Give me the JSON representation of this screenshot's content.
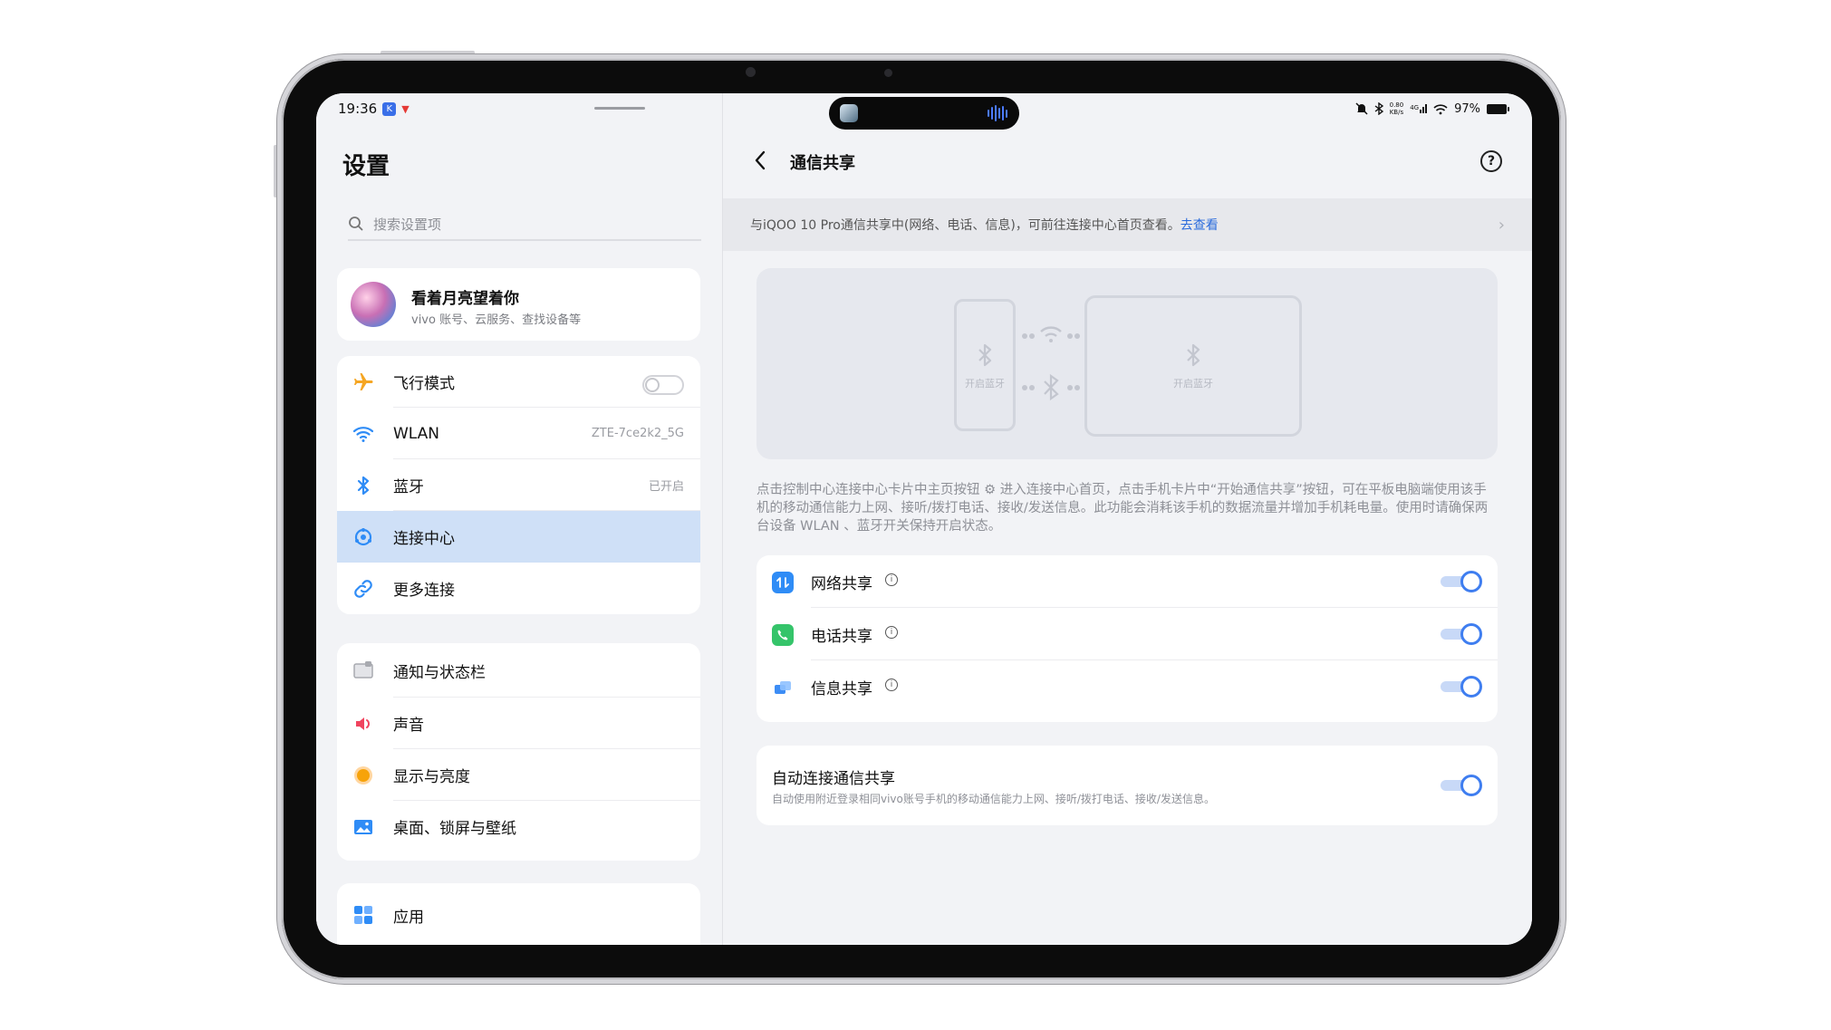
{
  "status": {
    "time": "19:36",
    "netspeed_top": "0.80",
    "netspeed_bottom": "KB/s",
    "network": "4G",
    "battery": "97%"
  },
  "left": {
    "title": "设置",
    "search_placeholder": "搜索设置项",
    "profile": {
      "name": "看着月亮望着你",
      "subtitle": "vivo 账号、云服务、查找设备等"
    },
    "group1": [
      {
        "label": "飞行模式",
        "icon": "airplane-icon",
        "value": ""
      },
      {
        "label": "WLAN",
        "icon": "wifi-icon",
        "value": "ZTE-7ce2k2_5G"
      },
      {
        "label": "蓝牙",
        "icon": "bluetooth-icon",
        "value": "已开启"
      },
      {
        "label": "连接中心",
        "icon": "connection-center-icon",
        "value": ""
      },
      {
        "label": "更多连接",
        "icon": "link-icon",
        "value": ""
      }
    ],
    "group2": [
      {
        "label": "通知与状态栏",
        "icon": "notification-icon"
      },
      {
        "label": "声音",
        "icon": "sound-icon"
      },
      {
        "label": "显示与亮度",
        "icon": "brightness-icon"
      },
      {
        "label": "桌面、锁屏与壁纸",
        "icon": "wallpaper-icon"
      }
    ],
    "group3": [
      {
        "label": "应用",
        "icon": "apps-icon"
      }
    ]
  },
  "right": {
    "title": "通信共享",
    "banner_text": "与iQOO 10 Pro通信共享中(网络、电话、信息)，可前往连接中心首页查看。",
    "banner_link": "去查看",
    "illustration": {
      "phone_label": "开启蓝牙",
      "tablet_label": "开启蓝牙"
    },
    "description": "点击控制中心连接中心卡片中主页按钮 ⚙ 进入连接中心首页，点击手机卡片中“开始通信共享”按钮，可在平板电脑端使用该手机的移动通信能力上网、接听/拨打电话、接收/发送信息。此功能会消耗该手机的数据流量并增加手机耗电量。使用时请确保两台设备 WLAN 、蓝牙开关保持开启状态。",
    "features": [
      {
        "label": "网络共享",
        "icon": "network-share-icon",
        "color": "#2f8cf6",
        "enabled": true
      },
      {
        "label": "电话共享",
        "icon": "phone-share-icon",
        "color": "#35c46a",
        "enabled": true
      },
      {
        "label": "信息共享",
        "icon": "message-share-icon",
        "color": "#3d8df5",
        "enabled": true
      }
    ],
    "auto": {
      "title": "自动连接通信共享",
      "subtitle": "自动使用附近登录相同vivo账号手机的移动通信能力上网、接听/拨打电话、接收/发送信息。",
      "enabled": true
    }
  },
  "colors": {
    "accent": "#3f7ef0",
    "selected_bg": "#cfe0f7",
    "link": "#2a6bdc"
  }
}
